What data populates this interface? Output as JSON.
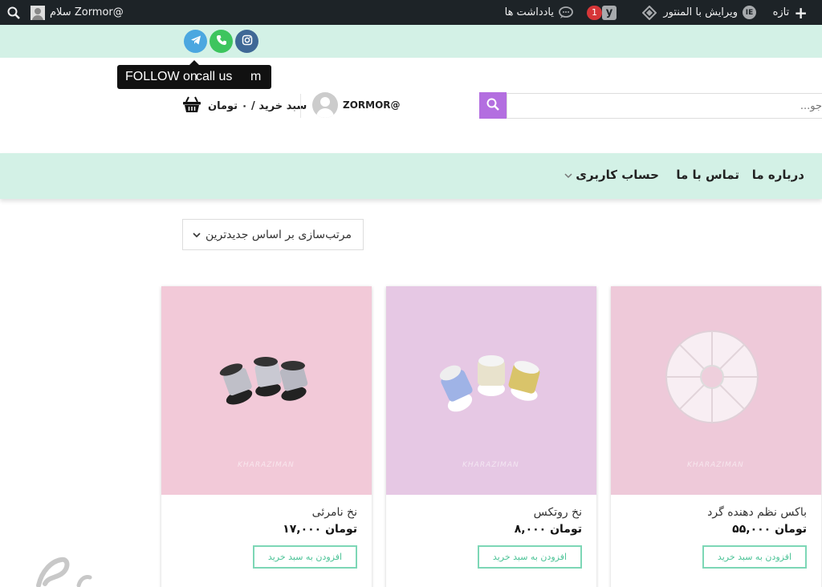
{
  "admin_bar": {
    "new_label": "تازه",
    "elementor_label": "ویرایش با المنتور",
    "notification_count": "1",
    "comments_label": "یادداشت ها",
    "greeting": "سلام Zormor@"
  },
  "social": {
    "tooltip_parts": [
      "FOLLOW on",
      "call us",
      "m"
    ],
    "icons": [
      "telegram-icon",
      "phone-icon",
      "instagram-icon"
    ]
  },
  "header": {
    "cart_label": "سبد خرید / ۰ تومان",
    "username": "ZORMOR@",
    "search_placeholder": "جو..."
  },
  "nav": {
    "items": [
      "درباره ما",
      "تماس با ما",
      "حساب کاربری"
    ]
  },
  "sort": {
    "selected": "مرتب‌سازی بر اساس جدیدترین"
  },
  "products": [
    {
      "title": "نخ نامرئی",
      "price": "۱۷,۰۰۰ تومان",
      "button": "افزودن به سبد خرید",
      "watermark": "KHARAZIMAN"
    },
    {
      "title": "نخ روتکس",
      "price": "۸,۰۰۰ تومان",
      "button": "افزودن به سبد خرید",
      "watermark": "KHARAZIMAN"
    },
    {
      "title": "باکس نظم دهنده گرد",
      "price": "۵۵,۰۰۰ تومان",
      "button": "افزودن به سبد خرید",
      "watermark": "KHARAZIMAN"
    }
  ],
  "colors": {
    "admin_bar": "#1d2327",
    "mint": "#d3f1e6",
    "search_accent": "#b36ee0",
    "button_border": "#7dd7b6"
  }
}
